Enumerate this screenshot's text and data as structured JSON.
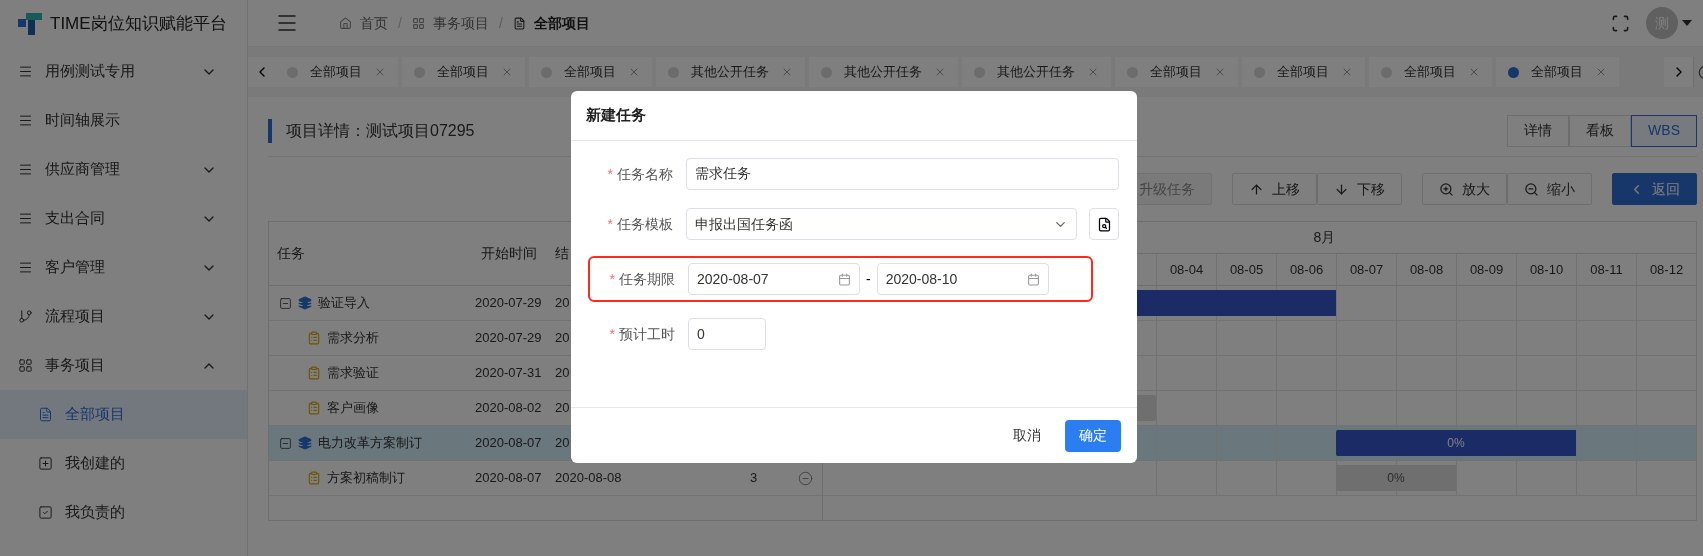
{
  "sidebar": {
    "logo": "TIME岗位知识赋能平台",
    "items": [
      {
        "label": "用例测试专用",
        "kind": "group",
        "expanded": false,
        "selected": false
      },
      {
        "label": "时间轴展示",
        "kind": "link",
        "selected": false
      },
      {
        "label": "供应商管理",
        "kind": "group",
        "expanded": false,
        "selected": false
      },
      {
        "label": "支出合同",
        "kind": "group",
        "expanded": false,
        "selected": false
      },
      {
        "label": "客户管理",
        "kind": "group",
        "expanded": false,
        "selected": false
      },
      {
        "label": "流程项目",
        "kind": "group",
        "expanded": false,
        "selected": false
      },
      {
        "label": "事务项目",
        "kind": "group",
        "expanded": true,
        "selected": false
      },
      {
        "label": "全部项目",
        "kind": "sub",
        "selected": true
      },
      {
        "label": "我创建的",
        "kind": "sub",
        "selected": false
      },
      {
        "label": "我负责的",
        "kind": "sub",
        "selected": false
      }
    ]
  },
  "header": {
    "breadcrumb": [
      {
        "label": "首页",
        "current": false
      },
      {
        "label": "事务项目",
        "current": false
      },
      {
        "label": "全部项目",
        "current": true
      }
    ],
    "separator": "/",
    "avatar": "测"
  },
  "tabs": [
    {
      "label": "全部项目",
      "selected": false
    },
    {
      "label": "全部项目",
      "selected": false
    },
    {
      "label": "全部项目",
      "selected": false
    },
    {
      "label": "其他公开任务",
      "selected": false
    },
    {
      "label": "其他公开任务",
      "selected": false
    },
    {
      "label": "其他公开任务",
      "selected": false
    },
    {
      "label": "全部项目",
      "selected": false
    },
    {
      "label": "全部项目",
      "selected": false
    },
    {
      "label": "全部项目",
      "selected": false
    },
    {
      "label": "全部项目",
      "selected": true
    }
  ],
  "page_title": "项目详情：测试项目07295",
  "view_switch": [
    {
      "label": "详情",
      "selected": false
    },
    {
      "label": "看板",
      "selected": false
    },
    {
      "label": "WBS",
      "selected": true
    }
  ],
  "toolbar": [
    {
      "buttons": [
        {
          "label": "升级任务",
          "kind": "default",
          "disabled": true
        }
      ]
    },
    {
      "buttons": [
        {
          "label": "上移",
          "kind": "default",
          "disabled": false
        },
        {
          "label": "下移",
          "kind": "default",
          "disabled": false
        }
      ]
    },
    {
      "buttons": [
        {
          "label": "放大",
          "kind": "default",
          "disabled": false
        },
        {
          "label": "缩小",
          "kind": "default",
          "disabled": false
        }
      ]
    },
    {
      "buttons": [
        {
          "label": "返回",
          "kind": "primary",
          "disabled": false
        }
      ]
    }
  ],
  "table": {
    "columns": [
      "任务",
      "开始时间",
      "结"
    ],
    "rows": [
      {
        "name": "验证导入",
        "kind": "summary",
        "expanded": true,
        "selected": false,
        "start": "2020-07-29",
        "end": "20",
        "bar": {
          "kind": "summary",
          "before": true,
          "cells": [
            true,
            true,
            true,
            false,
            false,
            false,
            false,
            false,
            false
          ]
        },
        "children": [
          {
            "name": "需求分析",
            "kind": "task",
            "selected": false,
            "start": "2020-07-29",
            "end": "20"
          },
          {
            "name": "需求验证",
            "kind": "task",
            "selected": false,
            "start": "2020-07-31",
            "end": "20"
          },
          {
            "name": "客户画像",
            "kind": "task",
            "selected": false,
            "start": "2020-08-02",
            "end": "20",
            "bar": {
              "kind": "task",
              "before": true,
              "cells": [
                false,
                false,
                false,
                false,
                false,
                false,
                false,
                false,
                false
              ]
            }
          }
        ]
      },
      {
        "name": "电力改革方案制订",
        "kind": "summary",
        "expanded": true,
        "selected": true,
        "start": "2020-08-07",
        "end": "20",
        "bar": {
          "kind": "summary",
          "label": "0%",
          "before": false,
          "cells": [
            false,
            false,
            false,
            true,
            true,
            true,
            true,
            false,
            false
          ]
        },
        "children": [
          {
            "name": "方案初稿制订",
            "kind": "task",
            "selected": false,
            "start": "2020-08-07",
            "end": "2020-08-08",
            "duration": "3",
            "bar": {
              "kind": "task",
              "label": "0%",
              "before": false,
              "cells": [
                false,
                false,
                false,
                true,
                true,
                false,
                false,
                false,
                false
              ]
            }
          }
        ]
      }
    ]
  },
  "gantt": {
    "month": "8月",
    "dates": [
      "08-04",
      "08-05",
      "08-06",
      "08-07",
      "08-08",
      "08-09",
      "08-10",
      "08-11",
      "08-12"
    ]
  },
  "modal": {
    "title": "新建任务",
    "required_mark": "*",
    "fields": [
      {
        "kind": "text",
        "label": "任务名称",
        "required": true,
        "highlighted": false,
        "value": "需求任务"
      },
      {
        "kind": "select",
        "label": "任务模板",
        "required": true,
        "highlighted": false,
        "value": "申报出国任务函"
      },
      {
        "kind": "daterange",
        "label": "任务期限",
        "required": true,
        "highlighted": true,
        "start": "2020-08-07",
        "separator": "-",
        "end": "2020-08-10"
      },
      {
        "kind": "number",
        "label": "预计工时",
        "required": true,
        "highlighted": false,
        "value": "0"
      }
    ],
    "buttons": [
      {
        "label": "取消",
        "kind": "default"
      },
      {
        "label": "确定",
        "kind": "primary"
      }
    ]
  }
}
